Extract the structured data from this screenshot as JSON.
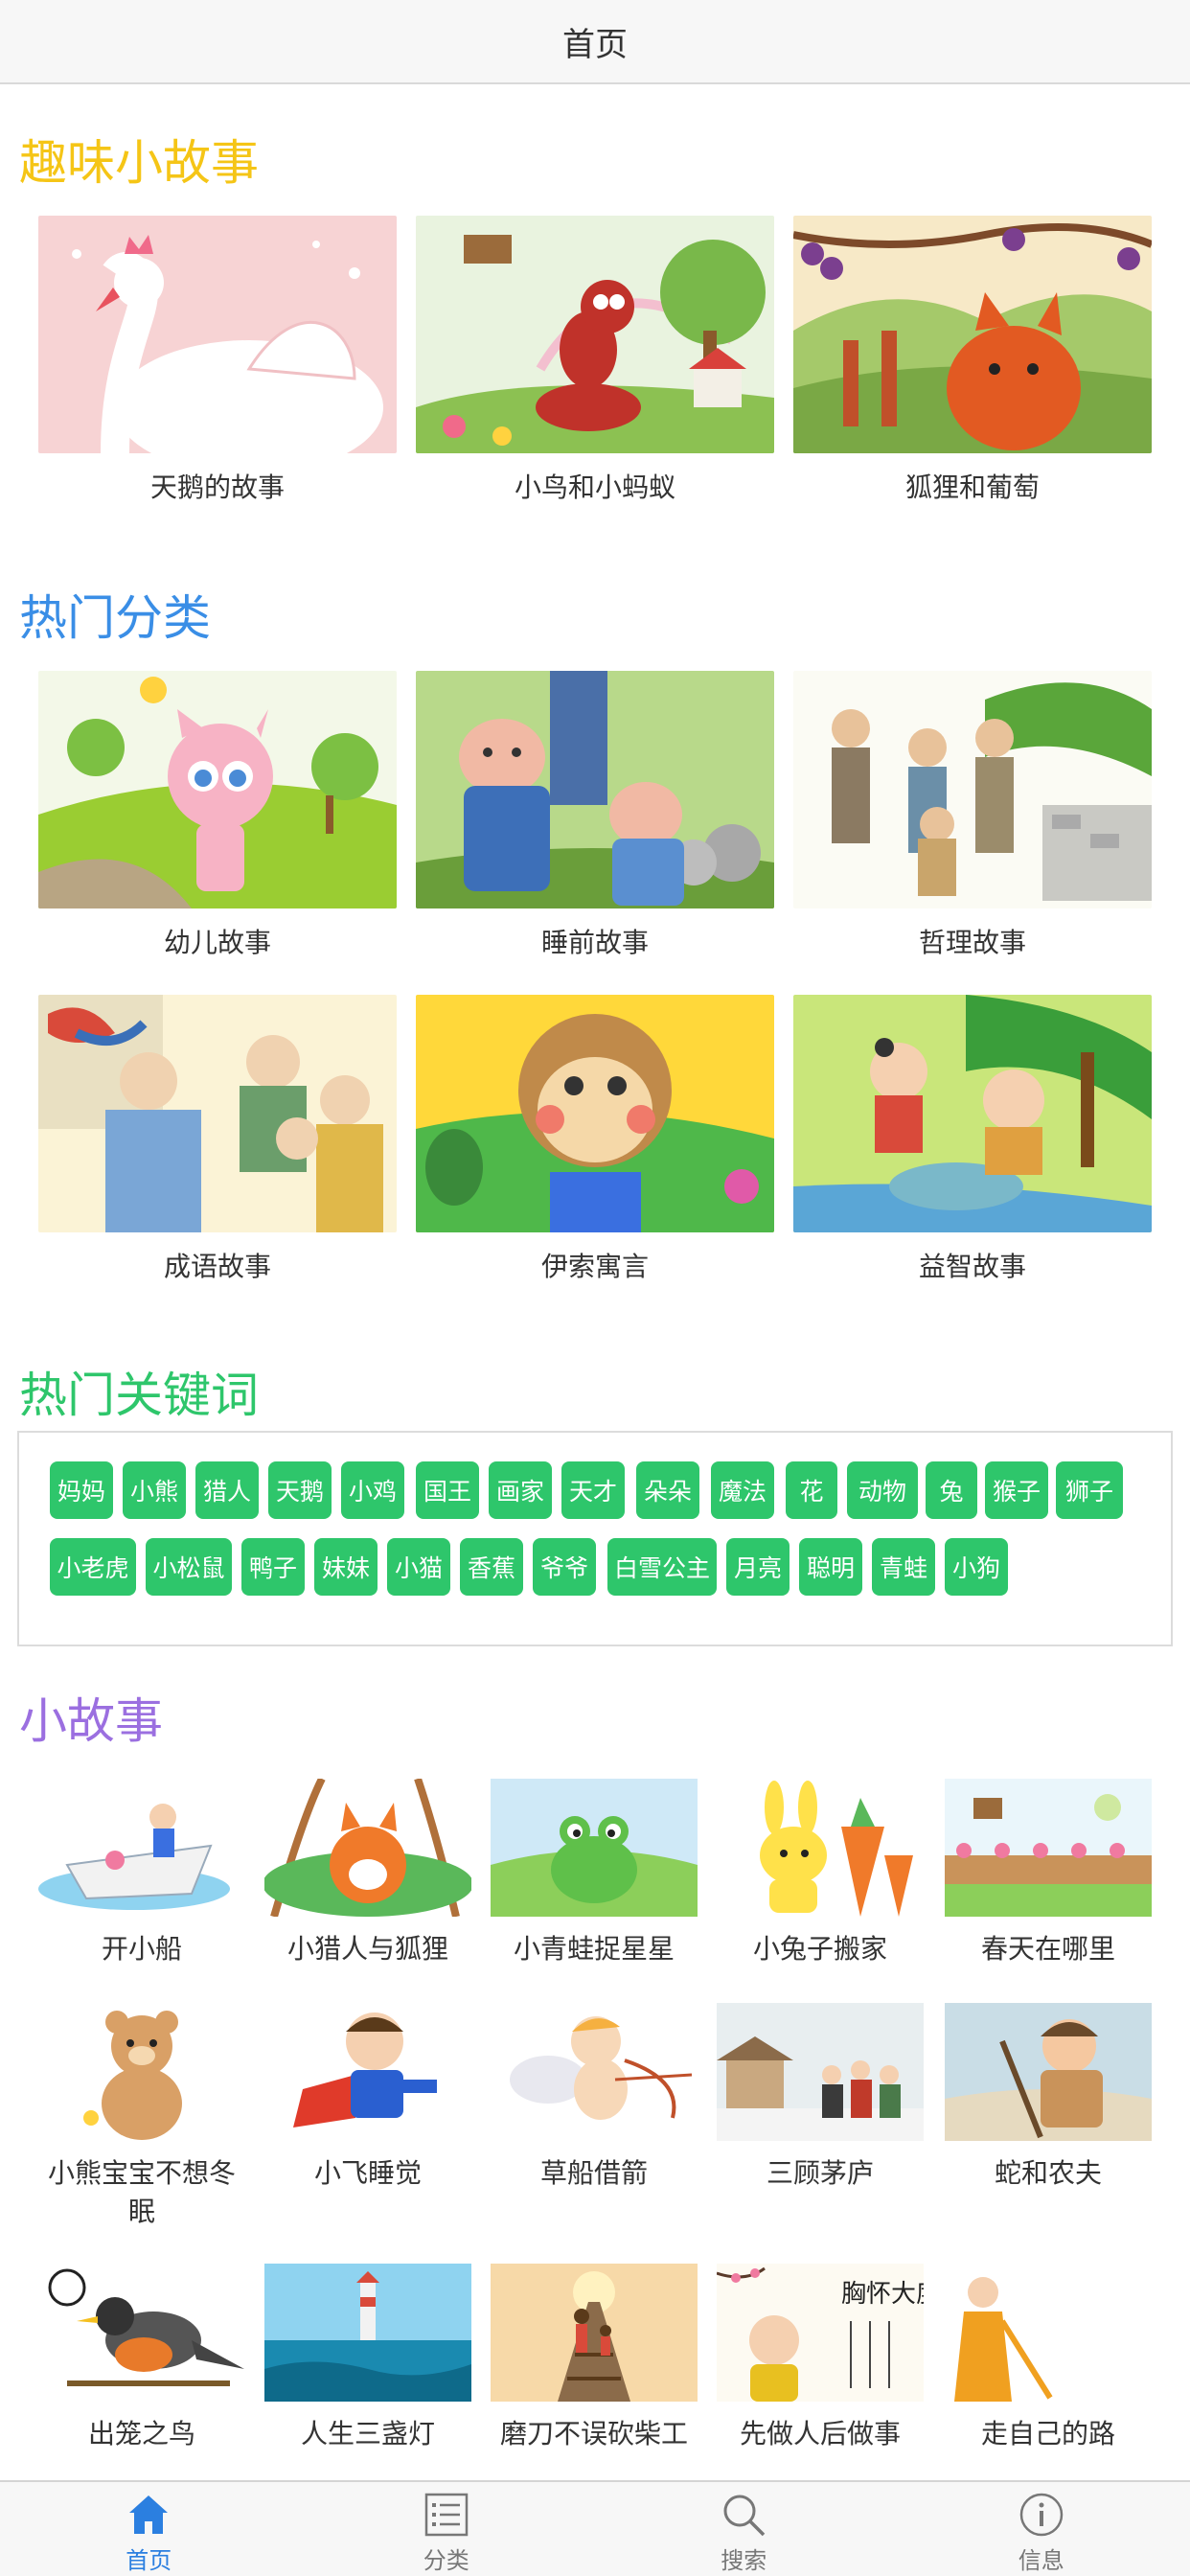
{
  "header": {
    "title": "首页"
  },
  "sections": {
    "fun": {
      "title": "趣味小故事",
      "color": "#f5c516"
    },
    "hot_categories": {
      "title": "热门分类",
      "color": "#3a8ee6"
    },
    "hot_keywords": {
      "title": "热门关键词",
      "color": "#2ec66b"
    },
    "short_stories": {
      "title": "小故事",
      "color": "#9b6fe0"
    }
  },
  "fun_stories": [
    {
      "label": "天鹅的故事",
      "icon": "swan-image"
    },
    {
      "label": "小鸟和小蚂蚁",
      "icon": "ant-image"
    },
    {
      "label": "狐狸和葡萄",
      "icon": "fox-grapes-image"
    }
  ],
  "categories": [
    {
      "label": "幼儿故事",
      "icon": "cat-girl-image"
    },
    {
      "label": "睡前故事",
      "icon": "pigs-image"
    },
    {
      "label": "哲理故事",
      "icon": "villagers-image"
    },
    {
      "label": "成语故事",
      "icon": "ancient-painting-image"
    },
    {
      "label": "伊索寓言",
      "icon": "monkey-image"
    },
    {
      "label": "益智故事",
      "icon": "kids-well-image"
    }
  ],
  "keywords": [
    "妈妈",
    "小熊",
    "猎人",
    "天鹅",
    "小鸡",
    "国王",
    "画家",
    "天才",
    "朵朵",
    "魔法",
    "花",
    "动物",
    "兔",
    "猴子",
    "狮子",
    "小老虎",
    "小松鼠",
    "鸭子",
    "妹妹",
    "小猫",
    "香蕉",
    "爷爷",
    "白雪公主",
    "月亮",
    "聪明",
    "青蛙",
    "小狗"
  ],
  "short_stories": [
    {
      "label": "开小船",
      "icon": "boat-image"
    },
    {
      "label": "小猎人与狐狸",
      "icon": "fox-image"
    },
    {
      "label": "小青蛙捉星星",
      "icon": "frog-image"
    },
    {
      "label": "小兔子搬家",
      "icon": "rabbit-image"
    },
    {
      "label": "春天在哪里",
      "icon": "spring-image"
    },
    {
      "label": "小熊宝宝不想冬眠",
      "icon": "bear-image"
    },
    {
      "label": "小飞睡觉",
      "icon": "superhero-image"
    },
    {
      "label": "草船借箭",
      "icon": "cupid-image"
    },
    {
      "label": "三顾茅庐",
      "icon": "snow-village-image"
    },
    {
      "label": "蛇和农夫",
      "icon": "farmer-image"
    },
    {
      "label": "出笼之鸟",
      "icon": "bird-image"
    },
    {
      "label": "人生三盏灯",
      "icon": "lighthouse-image"
    },
    {
      "label": "磨刀不误砍柴工",
      "icon": "railway-image"
    },
    {
      "label": "先做人后做事",
      "icon": "monk-calligraphy-image"
    },
    {
      "label": "走自己的路",
      "icon": "monk-image"
    }
  ],
  "calligraphy_text": "胸怀大度",
  "tabbar": [
    {
      "label": "首页",
      "icon": "home-icon",
      "active": true
    },
    {
      "label": "分类",
      "icon": "list-icon",
      "active": false
    },
    {
      "label": "搜索",
      "icon": "search-icon",
      "active": false
    },
    {
      "label": "信息",
      "icon": "info-icon",
      "active": false
    }
  ],
  "colors": {
    "accent": "#2b7fe0",
    "tag": "#2ec66b"
  }
}
